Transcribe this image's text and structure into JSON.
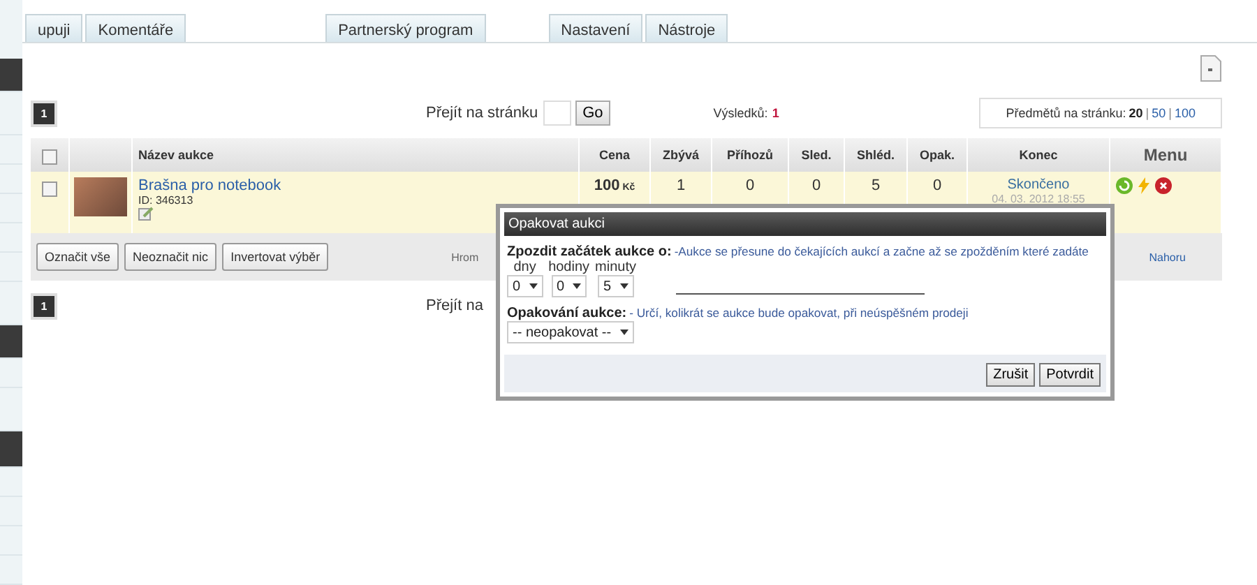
{
  "tabs": [
    {
      "label": "upuji",
      "selected": false
    },
    {
      "label": "Komentáře",
      "selected": false
    },
    {
      "label": "Partnerský program",
      "selected": false
    },
    {
      "label": "Nastavení",
      "selected": false
    },
    {
      "label": "Nástroje",
      "selected": false
    }
  ],
  "pager_top": {
    "pages": [
      {
        "label": "1",
        "selected": true
      }
    ],
    "goto_label": "Přejít na stránku",
    "goto_button": "Go",
    "results_label": "Výsledků:",
    "results_count": "1",
    "per_page_label": "Předmětů na stránku:",
    "per_page_separator": "|",
    "per_page": [
      {
        "label": "20",
        "selected": true
      },
      {
        "label": "50",
        "selected": false
      },
      {
        "label": "100",
        "selected": false
      }
    ]
  },
  "table": {
    "all_checked": false,
    "columns": [
      "Název aukce",
      "Cena",
      "Zbývá",
      "Příhozů",
      "Sled.",
      "Shléd.",
      "Opak.",
      "Konec",
      "Menu"
    ],
    "rows": [
      {
        "checked": false,
        "name": "Brašna pro notebook",
        "id": "ID: 346313",
        "price": "100",
        "currency": "Kč",
        "remaining": "1",
        "bids": "0",
        "watching": "0",
        "views": "5",
        "repeats": "0",
        "status": "Skončeno",
        "end": "04. 03. 2012 18:55"
      }
    ]
  },
  "toolbar": {
    "buttons": [
      "Označit vše",
      "Neoznačit nic",
      "Invertovat výběr"
    ],
    "bulk_label": "Hrom",
    "top_link": "Nahoru"
  },
  "pager_bottom": {
    "pages": [
      {
        "label": "1",
        "selected": true
      }
    ],
    "goto_label": "Přejít na"
  },
  "dialog": {
    "title": "Opakovat aukci",
    "delay_label": "Zpozdit začátek aukce o:",
    "delay_hint": "-Aukce se přesune do čekajících aukcí a začne až se zpožděním které zadáte",
    "delay_fields": [
      {
        "label": "dny",
        "value": "0"
      },
      {
        "label": "hodiny",
        "value": "0"
      },
      {
        "label": "minuty",
        "value": "5"
      }
    ],
    "repeat_label": "Opakování aukce:",
    "repeat_hint": "- Určí, kolikrát se aukce bude opakovat, při neúspěšném prodeji",
    "repeat_value": "-- neopakovat --",
    "buttons": [
      "Zrušit",
      "Potvrdit"
    ]
  }
}
